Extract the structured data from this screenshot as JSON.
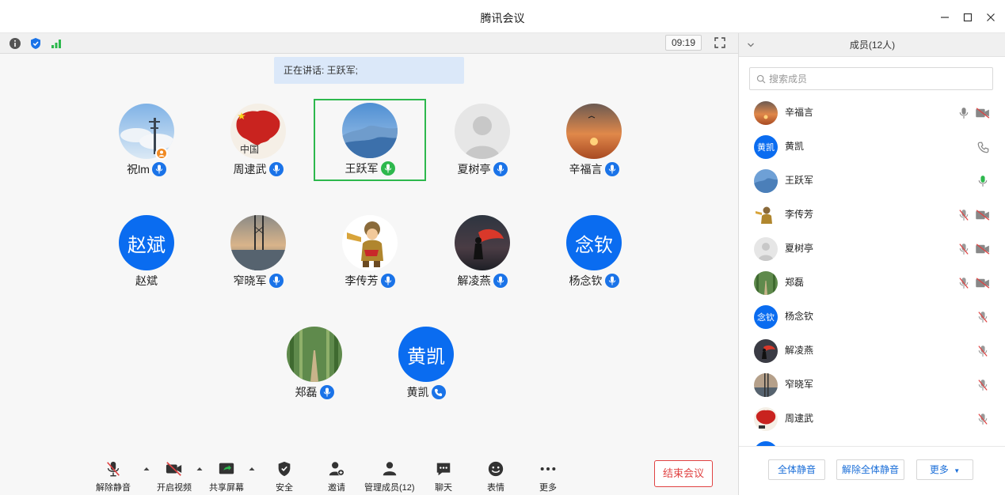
{
  "window": {
    "title": "腾讯会议"
  },
  "topbar": {
    "timer": "09:19"
  },
  "speaking": {
    "text": "正在讲话: 王跃军;"
  },
  "participants": [
    {
      "name": "祝lm",
      "mic": "on"
    },
    {
      "name": "周逮武",
      "mic": "on"
    },
    {
      "name": "王跃军",
      "mic": "speaking"
    },
    {
      "name": "夏树亭",
      "mic": "on"
    },
    {
      "name": "辛福言",
      "mic": "on"
    },
    {
      "name": "赵斌",
      "avatar_text": "赵斌"
    },
    {
      "name": "窄晓军",
      "mic": "on"
    },
    {
      "name": "李传芳",
      "mic": "on"
    },
    {
      "name": "解凌燕",
      "mic": "on"
    },
    {
      "name": "杨念钦",
      "avatar_text": "念钦",
      "mic": "on"
    },
    {
      "name": "郑磊",
      "mic": "on"
    },
    {
      "name": "黄凯",
      "avatar_text": "黄凯",
      "mic": "phone"
    }
  ],
  "toolbar": {
    "unmute": "解除静音",
    "start_video": "开启视频",
    "share_screen": "共享屏幕",
    "security": "安全",
    "invite": "邀请",
    "manage_members": "管理成员(12)",
    "chat": "聊天",
    "reactions": "表情",
    "more": "更多",
    "end_meeting": "结束会议"
  },
  "panel": {
    "title": "成员(12人)",
    "search_placeholder": "搜索成员",
    "members": [
      {
        "name": "辛福言",
        "mic": "on",
        "video": "off"
      },
      {
        "name": "黄凯",
        "avatar_text": "黄凯",
        "audio": "phone"
      },
      {
        "name": "王跃军",
        "mic": "speaking"
      },
      {
        "name": "李传芳",
        "mic": "muted",
        "video": "off"
      },
      {
        "name": "夏树亭",
        "mic": "muted",
        "video": "off"
      },
      {
        "name": "郑磊",
        "mic": "muted",
        "video": "off"
      },
      {
        "name": "杨念钦",
        "avatar_text": "念钦",
        "mic": "muted"
      },
      {
        "name": "解凌燕",
        "mic": "muted"
      },
      {
        "name": "窄晓军",
        "mic": "muted"
      },
      {
        "name": "周逮武",
        "mic": "muted"
      }
    ],
    "mute_all": "全体静音",
    "unmute_all": "解除全体静音",
    "more": "更多"
  },
  "colors": {
    "accent": "#1a73e8",
    "speaking": "#2db84d",
    "danger": "#e04343"
  }
}
